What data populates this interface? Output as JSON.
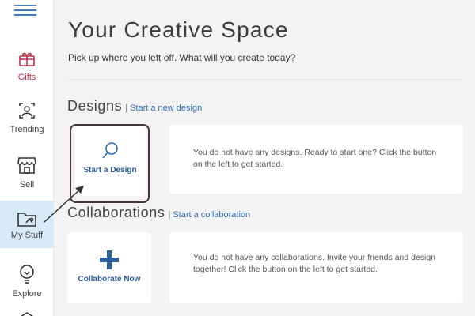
{
  "sidebar": {
    "items": [
      {
        "label": "Gifts",
        "icon": "gift-icon"
      },
      {
        "label": "Trending",
        "icon": "trending-icon"
      },
      {
        "label": "Sell",
        "icon": "store-icon"
      },
      {
        "label": "My Stuff",
        "icon": "folder-icon",
        "active": true
      },
      {
        "label": "Explore",
        "icon": "lightbulb-icon"
      }
    ]
  },
  "main": {
    "title": "Your Creative Space",
    "subtitle": "Pick up where you left off. What will you create today?",
    "designs": {
      "heading": "Designs",
      "separator": "|",
      "link": "Start a new design",
      "tile_label": "Start a Design",
      "message": "You do not have any designs. Ready to start one? Click the button on the left to get started."
    },
    "collaborations": {
      "heading": "Collaborations",
      "separator": "|",
      "link": "Start a collaboration",
      "tile_label": "Collaborate Now",
      "message": "You do not have any collaborations. Invite your friends and design together! Click the button on the left to get started."
    }
  },
  "colors": {
    "accent": "#2f6db5",
    "gifts": "#c0304a",
    "active_bg": "#d6eaf8",
    "annotation": "#4a3434"
  }
}
